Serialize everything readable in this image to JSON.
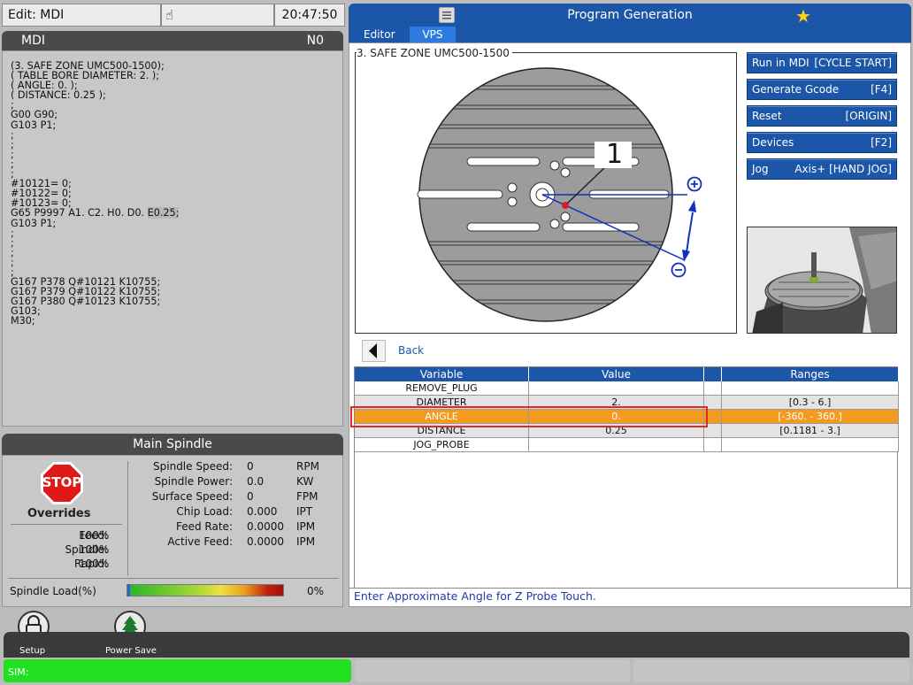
{
  "top": {
    "edit_label": "Edit: MDI",
    "clock": "20:47:50"
  },
  "mdi": {
    "title": "MDI",
    "line": "N0",
    "code": [
      "(3. SAFE ZONE UMC500-1500);",
      "( TABLE BORE DIAMETER: 2. );",
      "( ANGLE: 0. );",
      "( DISTANCE: 0.25 );",
      ";",
      "G00 G90;",
      "G103 P1;",
      ";",
      ";",
      ";",
      ";",
      ";",
      "#10121= 0;",
      "#10122= 0;",
      "#10123= 0;",
      "G65 P9997 A1. C2. H0. D0. ",
      "G103 P1;",
      ";",
      ";",
      ";",
      ";",
      ";",
      "G167 P378 Q#10121 K10755;",
      "G167 P379 Q#10122 K10755;",
      "G167 P380 Q#10123 K10755;",
      "G103;",
      "M30;"
    ],
    "code_highlight": "E0.25;"
  },
  "spindle": {
    "title": "Main Spindle",
    "stop": "STOP",
    "overrides_title": "Overrides",
    "overrides": [
      {
        "label": "Feed:",
        "value": "100%"
      },
      {
        "label": "Spindle:",
        "value": "100%"
      },
      {
        "label": "Rapid:",
        "value": "100%"
      }
    ],
    "stats": [
      {
        "label": "Spindle Speed:",
        "value": "0",
        "unit": "RPM"
      },
      {
        "label": "Spindle Power:",
        "value": "0.0",
        "unit": "KW"
      },
      {
        "label": "Surface Speed:",
        "value": "0",
        "unit": "FPM"
      },
      {
        "label": "Chip Load:",
        "value": "0.000",
        "unit": "IPT"
      },
      {
        "label": "Feed Rate:",
        "value": "0.0000",
        "unit": "IPM"
      },
      {
        "label": "Active Feed:",
        "value": "0.0000",
        "unit": "IPM"
      }
    ],
    "load_label": "Spindle Load(%)",
    "load_value": "0%",
    "load_fraction": 0.0
  },
  "program": {
    "title": "Program Generation",
    "tabs": [
      {
        "label": "Editor"
      },
      {
        "label": "VPS"
      }
    ],
    "diagram_title": "3. SAFE ZONE UMC500-1500",
    "callout": "1",
    "buttons": [
      {
        "label": "Run in MDI",
        "key": "[CYCLE START]"
      },
      {
        "label": "Generate Gcode",
        "key": "[F4]"
      },
      {
        "label": "Reset",
        "key": "[ORIGIN]"
      },
      {
        "label": "Devices",
        "key": "[F2]"
      },
      {
        "label": "Jog",
        "key": "Axis+ [HAND JOG]"
      }
    ],
    "back": "Back",
    "table": {
      "headers": [
        "Variable",
        "Value",
        "",
        "Ranges"
      ],
      "rows": [
        [
          "REMOVE_PLUG",
          "",
          "",
          ""
        ],
        [
          "DIAMETER",
          "2.",
          "",
          "[0.3 - 6.]"
        ],
        [
          "ANGLE",
          "0.",
          "",
          "[-360. - 360.]"
        ],
        [
          "DISTANCE",
          "0.25",
          "",
          "[0.1181 - 3.]"
        ],
        [
          "JOG_PROBE",
          "",
          "",
          ""
        ]
      ]
    },
    "hint": "Enter Approximate Angle for Z Probe Touch."
  },
  "bottom": {
    "setup": "Setup",
    "power_save": "Power Save",
    "sim": "SIM:"
  },
  "colors": {
    "accent_blue": "#1c56a8",
    "selected_row": "#f39a1f",
    "sim_green": "#20e020",
    "panel_dark": "#4a4a4a"
  }
}
